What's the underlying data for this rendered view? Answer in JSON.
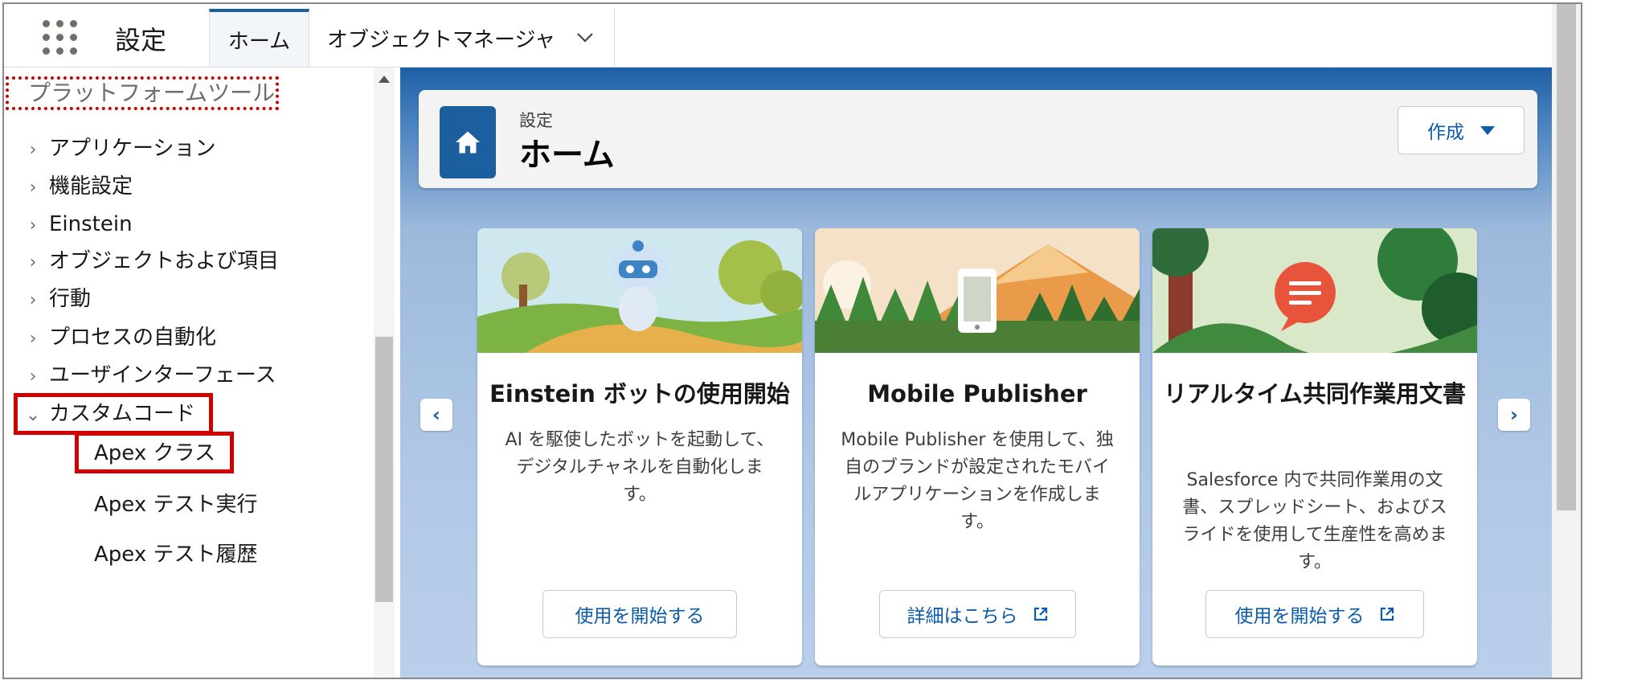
{
  "app_name": "設定",
  "tabs": {
    "home": "ホーム",
    "object_manager": "オブジェクトマネージャ"
  },
  "sidebar": {
    "section_header": "プラットフォームツール",
    "items": [
      {
        "label": "アプリケーション"
      },
      {
        "label": "機能設定"
      },
      {
        "label": "Einstein"
      },
      {
        "label": "オブジェクトおよび項目"
      },
      {
        "label": "行動"
      },
      {
        "label": "プロセスの自動化"
      },
      {
        "label": "ユーザインターフェース"
      },
      {
        "label": "カスタムコード"
      }
    ],
    "sub_items": [
      {
        "label": "Apex クラス"
      },
      {
        "label": "Apex テスト実行"
      },
      {
        "label": "Apex テスト履歴"
      }
    ]
  },
  "header": {
    "small_label": "設定",
    "title": "ホーム",
    "create_label": "作成"
  },
  "cards": [
    {
      "title": "Einstein ボットの使用開始",
      "desc": "AI を駆使したボットを起動して、デジタルチャネルを自動化します。",
      "button": "使用を開始する"
    },
    {
      "title": "Mobile Publisher",
      "desc": "Mobile Publisher を使用して、独自のブランドが設定されたモバイルアプリケーションを作成します。",
      "button": "詳細はこちら"
    },
    {
      "title": "リアルタイム共同作業用文書",
      "desc": "Salesforce 内で共同作業用の文書、スプレッドシート、およびスライドを使用して生産性を高めます。",
      "button": "使用を開始する"
    }
  ],
  "colors": {
    "brand_blue": "#1b5f9e",
    "link_blue": "#0b5cab",
    "highlight_red": "#d00000"
  }
}
